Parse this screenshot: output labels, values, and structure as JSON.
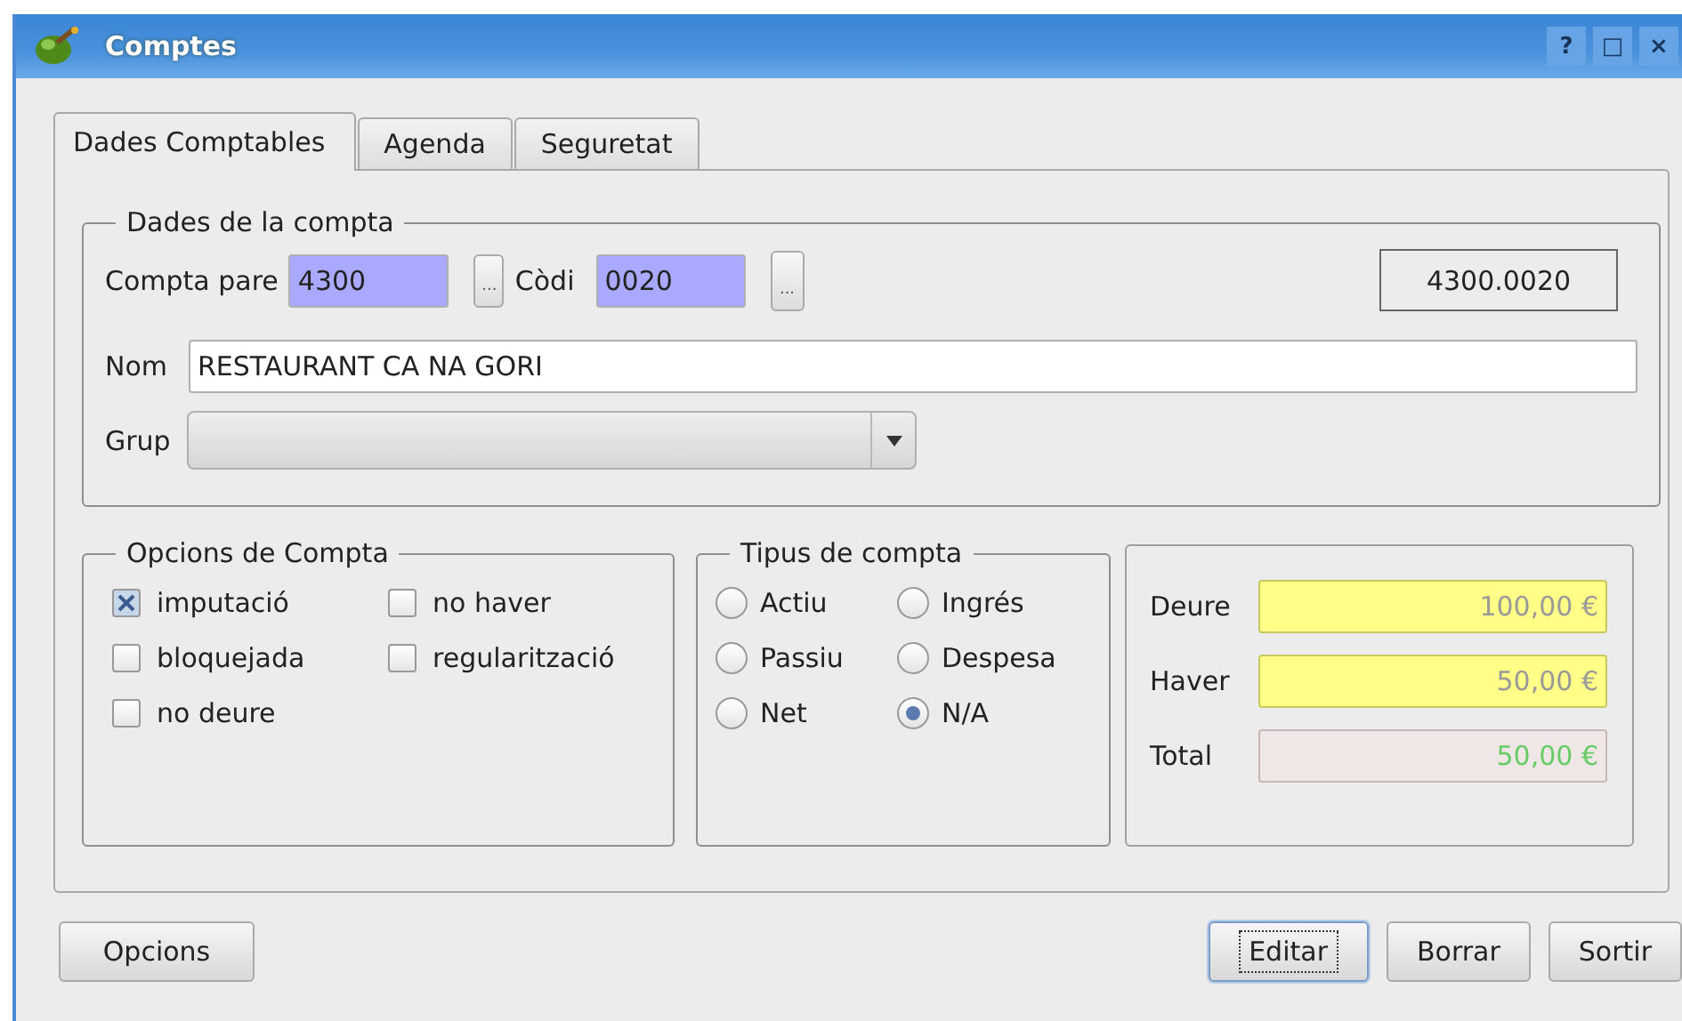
{
  "window": {
    "title": "Comptes",
    "controls": [
      "?",
      "□",
      "×"
    ]
  },
  "tabs": [
    {
      "label": "Dades Comptables",
      "selected": true
    },
    {
      "label": "Agenda",
      "selected": false
    },
    {
      "label": "Seguretat",
      "selected": false
    }
  ],
  "account_data": {
    "title": "Dades de la compta",
    "parent_label": "Compta pare",
    "parent_value": "4300",
    "parent_button": "...",
    "code_label": "Còdi",
    "code_value": "0020",
    "code_button": "...",
    "full_code": "4300.0020",
    "name_label": "Nom",
    "name_value": "RESTAURANT CA NA GORI",
    "group_label": "Grup"
  },
  "options": {
    "title": "Opcions de Compta",
    "items": [
      {
        "label": "imputació",
        "checked": true
      },
      {
        "label": "no haver",
        "checked": false
      },
      {
        "label": "bloquejada",
        "checked": false
      },
      {
        "label": "regularització",
        "checked": false
      },
      {
        "label": "no deure",
        "checked": false
      }
    ]
  },
  "account_type": {
    "title": "Tipus de compta",
    "items": [
      {
        "label": "Actiu",
        "selected": false
      },
      {
        "label": "Ingrés",
        "selected": false
      },
      {
        "label": "Passiu",
        "selected": false
      },
      {
        "label": "Despesa",
        "selected": false
      },
      {
        "label": "Net",
        "selected": false
      },
      {
        "label": "N/A",
        "selected": true
      }
    ]
  },
  "totals": [
    {
      "label": "Deure",
      "value": "100,00 €",
      "kind": "editable"
    },
    {
      "label": "Haver",
      "value": "50,00 €",
      "kind": "editable"
    },
    {
      "label": "Total",
      "value": "50,00 €",
      "kind": "result"
    }
  ],
  "left_buttons": [
    {
      "label": "Opcions",
      "focused": false
    }
  ],
  "right_buttons": [
    {
      "label": "Editar",
      "focused": true
    },
    {
      "label": "Borrar",
      "focused": false
    },
    {
      "label": "Sortir",
      "focused": false
    }
  ]
}
